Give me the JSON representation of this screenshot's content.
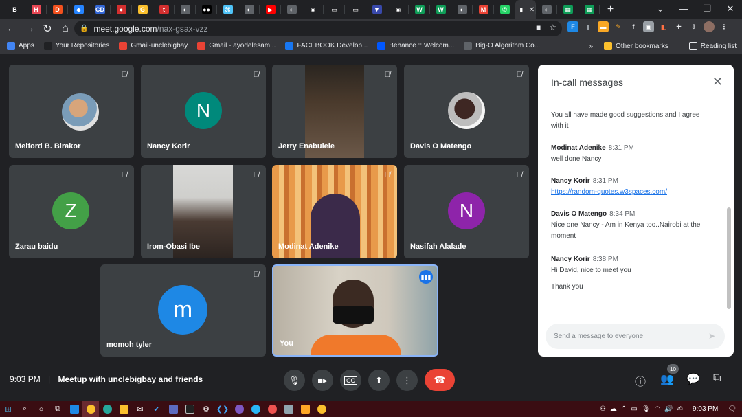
{
  "browser": {
    "tabs": [
      {
        "icon": "b-icon",
        "glyph": "B",
        "color": "#202124"
      },
      {
        "icon": "h-icon",
        "glyph": "H",
        "color": "#e84855"
      },
      {
        "icon": "d-icon",
        "glyph": "D",
        "color": "#f4511e"
      },
      {
        "icon": "jira-icon",
        "glyph": "◆",
        "color": "#2684ff"
      },
      {
        "icon": "cd-icon",
        "glyph": "CD",
        "color": "#3367d6"
      },
      {
        "icon": "record-icon",
        "glyph": "●",
        "color": "#d32f2f"
      },
      {
        "icon": "g-icon",
        "glyph": "G",
        "color": "#fbc02d"
      },
      {
        "icon": "t-icon",
        "glyph": "t",
        "color": "#d32f2f"
      },
      {
        "icon": "globe-icon",
        "glyph": "◐",
        "color": "#5f6368"
      },
      {
        "icon": "medium-icon",
        "glyph": "●●",
        "color": "#000000"
      },
      {
        "icon": "network-icon",
        "glyph": "⌘",
        "color": "#4fc3f7"
      },
      {
        "icon": "globe-icon",
        "glyph": "◐",
        "color": "#5f6368"
      },
      {
        "icon": "youtube-icon",
        "glyph": "▶",
        "color": "#ff0000"
      },
      {
        "icon": "globe-icon",
        "glyph": "◐",
        "color": "#5f6368"
      },
      {
        "icon": "github-icon",
        "glyph": "◉",
        "color": "#202124"
      },
      {
        "icon": "terminal-icon",
        "glyph": "▭",
        "color": "#202124"
      },
      {
        "icon": "terminal-icon",
        "glyph": "▭",
        "color": "#202124"
      },
      {
        "icon": "shirt-icon",
        "glyph": "▼",
        "color": "#3949ab"
      },
      {
        "icon": "github-icon",
        "glyph": "◉",
        "color": "#202124"
      },
      {
        "icon": "w-icon",
        "glyph": "W",
        "color": "#0f9d58"
      },
      {
        "icon": "w-icon",
        "glyph": "W",
        "color": "#0f9d58"
      },
      {
        "icon": "globe-icon",
        "glyph": "◐",
        "color": "#5f6368"
      },
      {
        "icon": "gmail-icon",
        "glyph": "M",
        "color": "#ea4335"
      },
      {
        "icon": "whatsapp-icon",
        "glyph": "✆",
        "color": "#25d366"
      },
      {
        "icon": "meet-icon",
        "glyph": "▮",
        "color": "#35363a"
      },
      {
        "icon": "globe-icon",
        "glyph": "◐",
        "color": "#5f6368"
      },
      {
        "icon": "sheets-icon",
        "glyph": "▦",
        "color": "#0f9d58"
      },
      {
        "icon": "sheets-icon",
        "glyph": "▦",
        "color": "#0f9d58"
      }
    ],
    "url_host": "meet.google.com",
    "url_path": "/nax-gsax-vzz",
    "bookmarks": [
      {
        "label": "Apps",
        "icon": "apps-icon",
        "color": "#4285f4"
      },
      {
        "label": "Your Repositories",
        "icon": "github-icon",
        "color": "#202124"
      },
      {
        "label": "Gmail-unclebigbay",
        "icon": "gmail-icon",
        "color": "#ea4335"
      },
      {
        "label": "Gmail - ayodelesam...",
        "icon": "gmail-icon",
        "color": "#ea4335"
      },
      {
        "label": "FACEBOOK Develop...",
        "icon": "facebook-icon",
        "color": "#1877f2"
      },
      {
        "label": "Behance :: Welcom...",
        "icon": "behance-icon",
        "color": "#0057ff"
      },
      {
        "label": "Big-O Algorithm Co...",
        "icon": "globe-icon",
        "color": "#5f6368"
      }
    ],
    "bookmarks_more": "»",
    "other_bookmarks": "Other bookmarks",
    "reading_list": "Reading list"
  },
  "meet": {
    "participants": [
      {
        "name": "Melford B. Birakor",
        "kind": "photo"
      },
      {
        "name": "Nancy Korir",
        "kind": "avatar",
        "initial": "N",
        "color": "#00897b"
      },
      {
        "name": "Jerry Enabulele",
        "kind": "video"
      },
      {
        "name": "Davis O Matengo",
        "kind": "photo"
      },
      {
        "name": "Zarau baidu",
        "kind": "avatar",
        "initial": "Z",
        "color": "#43a047"
      },
      {
        "name": "Irom-Obasi Ibe",
        "kind": "video"
      },
      {
        "name": "Modinat Adenike",
        "kind": "video"
      },
      {
        "name": "Nasifah Alalade",
        "kind": "avatar",
        "initial": "N",
        "color": "#8e24aa"
      },
      {
        "name": "momoh tyler",
        "kind": "avatar",
        "initial": "m",
        "color": "#1e88e5"
      },
      {
        "name": "You",
        "kind": "video"
      }
    ],
    "chat": {
      "title": "In-call messages",
      "messages": [
        {
          "sender": "",
          "time": "",
          "text": "You all have made good suggestions and I agree with it"
        },
        {
          "sender": "Modinat Adenike",
          "time": "8:31 PM",
          "text": "well done Nancy"
        },
        {
          "sender": "Nancy Korir",
          "time": "8:31 PM",
          "text": "https://random-quotes.w3spaces.com/",
          "is_link": true
        },
        {
          "sender": "Davis O Matengo",
          "time": "8:34 PM",
          "text": "Nice one Nancy - Am in Kenya too..Nairobi at the moment"
        },
        {
          "sender": "Nancy Korir",
          "time": "8:38 PM",
          "text": "Hi David, nice to meet you"
        },
        {
          "sender": "",
          "time": "",
          "text": "Thank you"
        }
      ],
      "input_placeholder": "Send a message to everyone"
    },
    "time": "9:03 PM",
    "separator": "|",
    "meeting_title": "Meetup with unclebigbay and friends",
    "participant_count": "10"
  },
  "taskbar": {
    "time": "9:03 PM"
  }
}
